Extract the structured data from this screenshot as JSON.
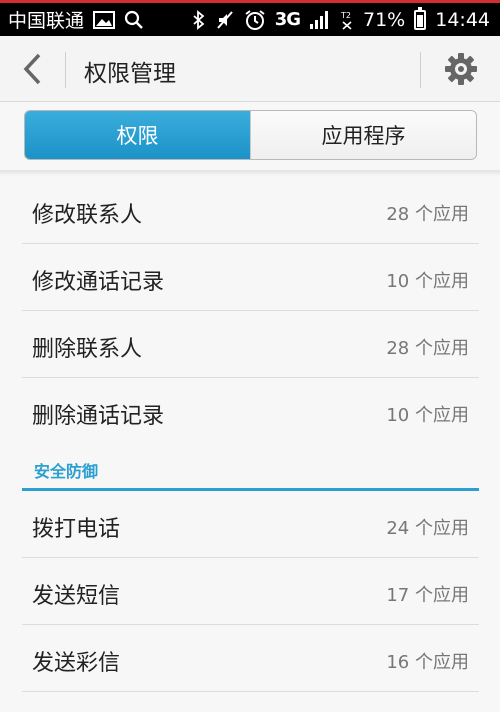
{
  "status_bar": {
    "carrier": "中国联通",
    "network": "3G",
    "battery": "71%",
    "battery_level": 0.71,
    "time": "14:44",
    "icons": [
      "image-icon",
      "search-icon",
      "bluetooth-icon",
      "mute-icon",
      "alarm-icon",
      "signal-icon",
      "battery-icon"
    ]
  },
  "header": {
    "title": "权限管理",
    "back_icon": "chevron-left-icon",
    "settings_icon": "gear-icon"
  },
  "tabs": [
    {
      "label": "权限",
      "active": true
    },
    {
      "label": "应用程序",
      "active": false
    }
  ],
  "list_group_1": [
    {
      "label": "修改联系人",
      "count": "28 个应用"
    },
    {
      "label": "修改通话记录",
      "count": "10 个应用"
    },
    {
      "label": "删除联系人",
      "count": "28 个应用"
    },
    {
      "label": "删除通话记录",
      "count": "10 个应用"
    }
  ],
  "section": {
    "title": "安全防御"
  },
  "list_group_2": [
    {
      "label": "拨打电话",
      "count": "24 个应用"
    },
    {
      "label": "发送短信",
      "count": "17 个应用"
    },
    {
      "label": "发送彩信",
      "count": "16 个应用"
    }
  ],
  "colors": {
    "accent": "#2a9fd0",
    "status_bar": "#000000",
    "text": "#222222",
    "secondary_text": "#777777"
  }
}
